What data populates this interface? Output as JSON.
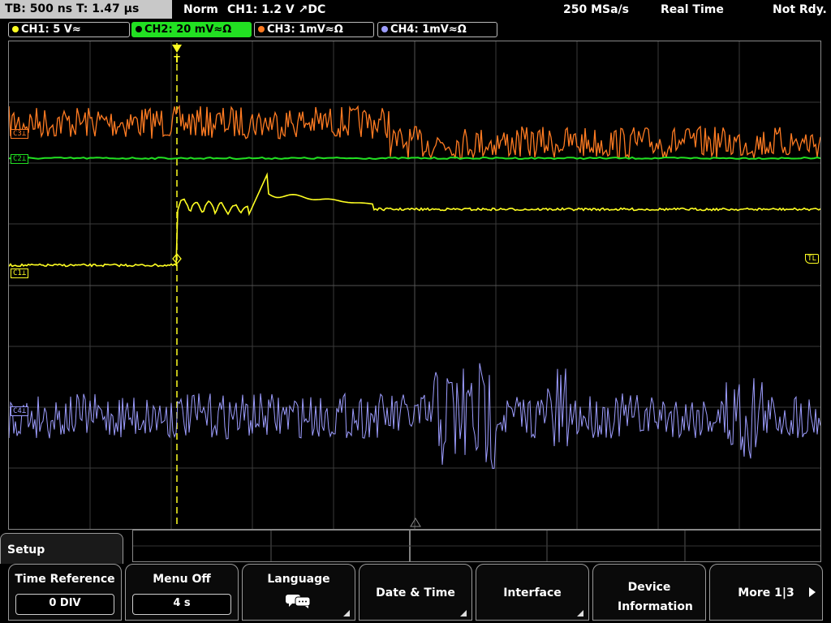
{
  "status": {
    "timebase": "TB: 500 ns  T: 1.47 µs",
    "trigger_mode": "Norm",
    "trigger_info": "CH1: 1.2 V ↗DC",
    "sample_rate": "250 MSa/s",
    "acq_mode": "Real Time",
    "ready_state": "Not Rdy."
  },
  "channels": [
    {
      "label": "CH1: 5 V≈",
      "color": "#ffff22",
      "active": false
    },
    {
      "label": "CH2: 20 mV≈Ω",
      "color": "#22e022",
      "active": true
    },
    {
      "label": "CH3: 1mV≈Ω",
      "color": "#ff7b22",
      "active": false
    },
    {
      "label": "CH4: 1mV≈Ω",
      "color": "#9d9dff",
      "active": false
    }
  ],
  "markers": {
    "c1": "C1⊥",
    "c2": "C2⊥",
    "c3": "C3⊥",
    "c4": "C4⊥",
    "tl": "TL",
    "trigger": "T"
  },
  "menu": {
    "title": "Setup",
    "softkeys": [
      {
        "label": "Time Reference",
        "value": "0 DIV"
      },
      {
        "label": "Menu Off",
        "value": "4 s"
      },
      {
        "label": "Language",
        "icon": "speech-bubbles-icon"
      },
      {
        "label": "Date & Time"
      },
      {
        "label": "Interface"
      },
      {
        "label": "Device Information"
      },
      {
        "label": "More 1|3"
      }
    ]
  },
  "colors": {
    "ch1": "#ffff22",
    "ch2": "#22e022",
    "ch3": "#ff7b22",
    "ch4": "#9d9dff",
    "grid": "#3a3a3a"
  }
}
